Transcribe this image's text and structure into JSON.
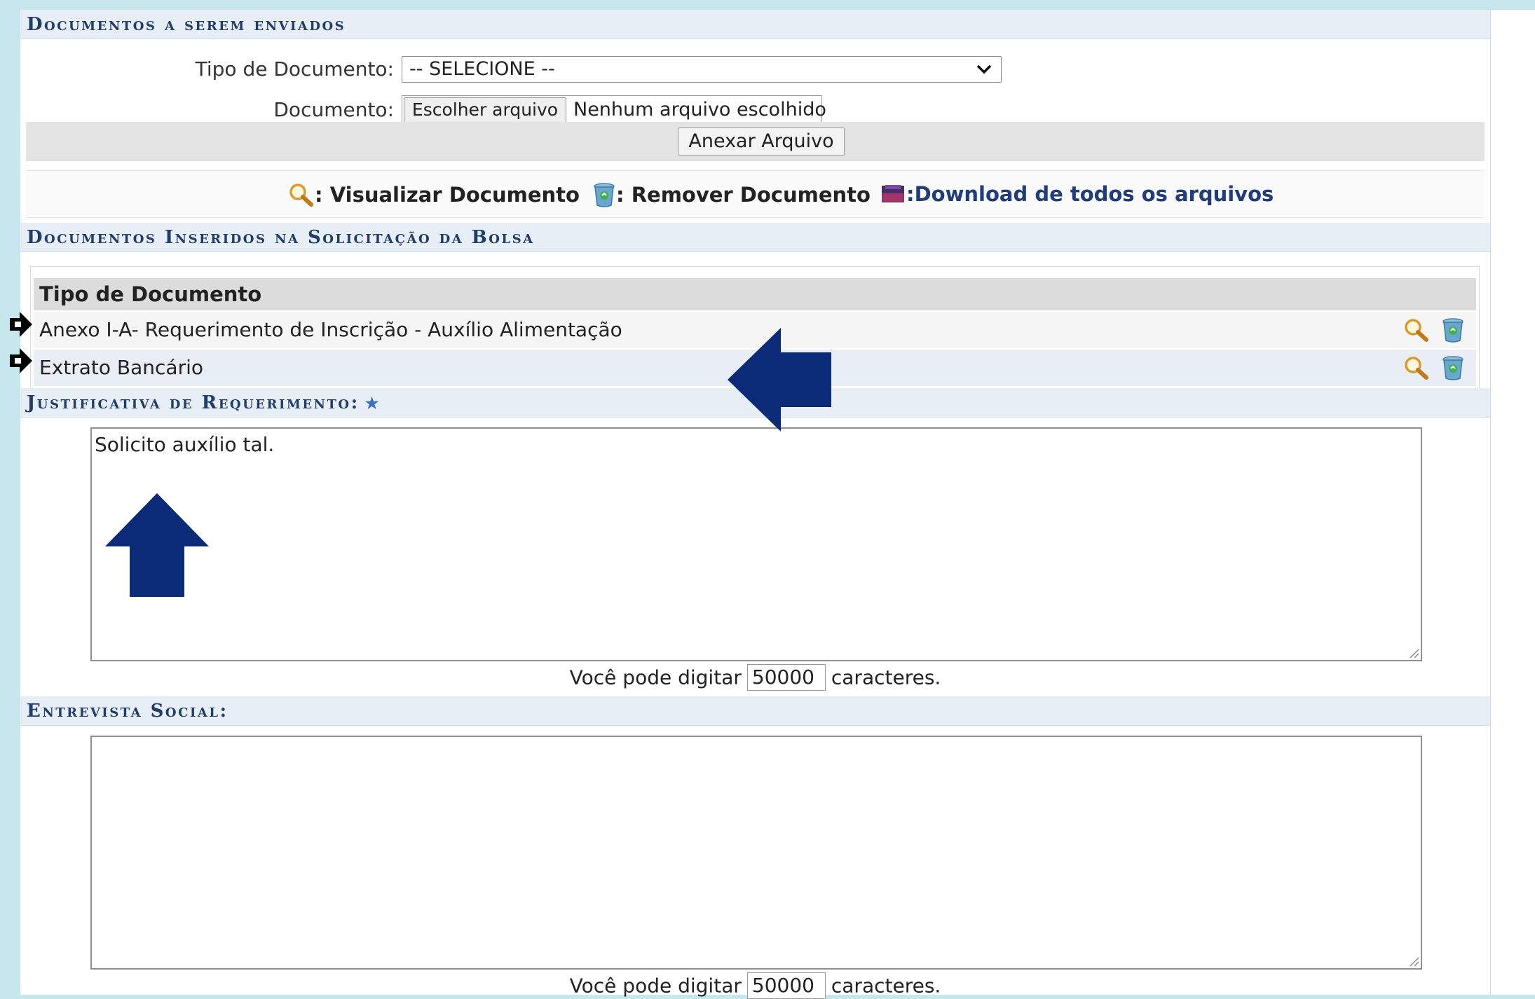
{
  "sections": {
    "upload_header": "Documentos a serem enviados",
    "inserted_header": "Documentos Inseridos na Solicitação da Bolsa",
    "justification_header": "Justificativa de Requerimento:",
    "interview_header": "Entrevista Social:"
  },
  "form": {
    "doc_type_label": "Tipo de Documento:",
    "doc_type_selected": "-- SELECIONE --",
    "document_label": "Documento:",
    "choose_file_button": "Escolher arquivo",
    "no_file_text": "Nenhum arquivo escolhido",
    "attach_button": "Anexar Arquivo"
  },
  "legend": {
    "view": ": Visualizar Documento",
    "remove": ": Remover Documento",
    "download_all": ":Download de todos os arquivos"
  },
  "table": {
    "header": "Tipo de Documento",
    "rows": [
      {
        "name": "Anexo I-A- Requerimento de Inscrição - Auxílio Alimentação"
      },
      {
        "name": "Extrato Bancário"
      }
    ]
  },
  "justification": {
    "text": "Solicito auxílio tal.",
    "counter_prefix": "Você pode digitar",
    "counter_value": "50000",
    "counter_suffix": "caracteres."
  },
  "interview": {
    "text": "",
    "counter_prefix": "Você pode digitar",
    "counter_value": "50000",
    "counter_suffix": "caracteres."
  },
  "colors": {
    "header_text": "#1f3d6b",
    "annotation_arrow": "#0b2a78",
    "page_border": "#c7e7ef"
  }
}
